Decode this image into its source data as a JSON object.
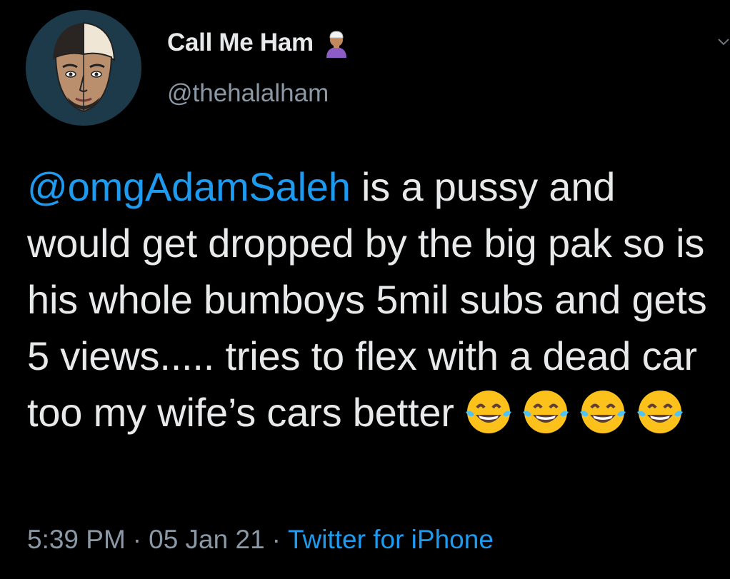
{
  "author": {
    "display_name": "Call Me Ham",
    "handle": "@thehalalham",
    "avatar_icon": "cartoon-face-avatar",
    "name_emoji": "person-with-skullcap-emoji"
  },
  "tweet": {
    "mention": "@omgAdamSaleh",
    "body": " is a pussy and would get dropped by the big pak so is his whole bumboys 5mil subs and gets 5 views..... tries to flex with a dead car too my wife’s cars better",
    "trailing_emojis": [
      "face-with-tears-of-joy",
      "face-with-tears-of-joy",
      "face-with-tears-of-joy",
      "face-with-tears-of-joy"
    ]
  },
  "meta": {
    "time": "5:39 PM",
    "separator": "·",
    "date": "05 Jan 21",
    "source": "Twitter for iPhone"
  },
  "colors": {
    "background": "#000000",
    "text": "#e7e9ea",
    "secondary": "#8b98a5",
    "link": "#1d9bf0"
  }
}
